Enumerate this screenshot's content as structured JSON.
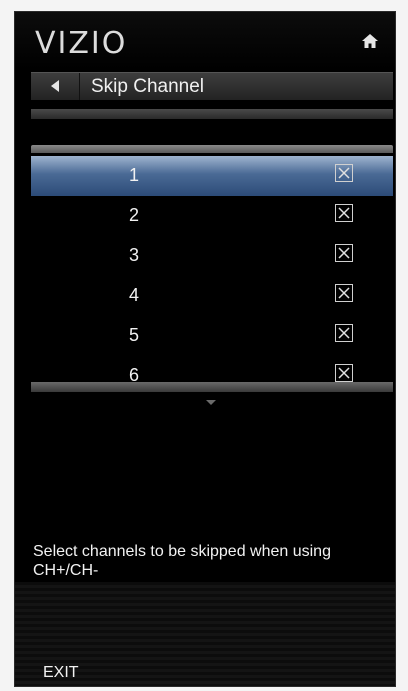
{
  "brand": {
    "logo": "VIZIO"
  },
  "menu": {
    "title": "Skip Channel"
  },
  "channels": [
    {
      "number": "1",
      "checked": true,
      "selected": true
    },
    {
      "number": "2",
      "checked": true,
      "selected": false
    },
    {
      "number": "3",
      "checked": true,
      "selected": false
    },
    {
      "number": "4",
      "checked": true,
      "selected": false
    },
    {
      "number": "5",
      "checked": true,
      "selected": false
    },
    {
      "number": "6",
      "checked": true,
      "selected": false
    }
  ],
  "help": {
    "description": "Select channels to be skipped when using CH+/CH-"
  },
  "footer": {
    "exit_label": "EXIT"
  },
  "icons": {
    "home": "home-icon",
    "back": "back-arrow-icon",
    "down": "scroll-down-icon",
    "checkbox": "checkbox-x-icon"
  },
  "colors": {
    "background": "#000000",
    "selection": "#2c4b78",
    "text": "#f2f2f2"
  }
}
